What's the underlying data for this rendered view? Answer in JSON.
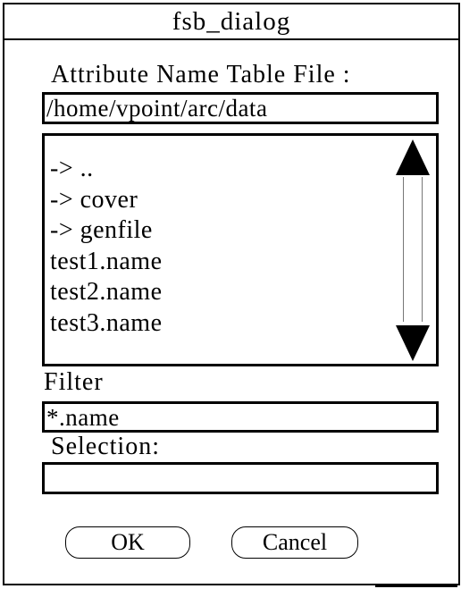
{
  "window": {
    "title": "fsb_dialog"
  },
  "directory": {
    "label": "Attribute Name Table File :",
    "path": "/home/vpoint/arc/data"
  },
  "file_list": {
    "items": [
      {
        "label": "-> .."
      },
      {
        "label": "-> cover"
      },
      {
        "label": "-> genfile"
      },
      {
        "label": "test1.name"
      },
      {
        "label": "test2.name"
      },
      {
        "label": "test3.name"
      }
    ],
    "scroll_up_icon": "triangle-up",
    "scroll_down_icon": "triangle-down"
  },
  "filter": {
    "label": "Filter",
    "value": "*.name"
  },
  "selection": {
    "label": "Selection:",
    "value": ""
  },
  "buttons": {
    "ok": "OK",
    "cancel": "Cancel"
  }
}
